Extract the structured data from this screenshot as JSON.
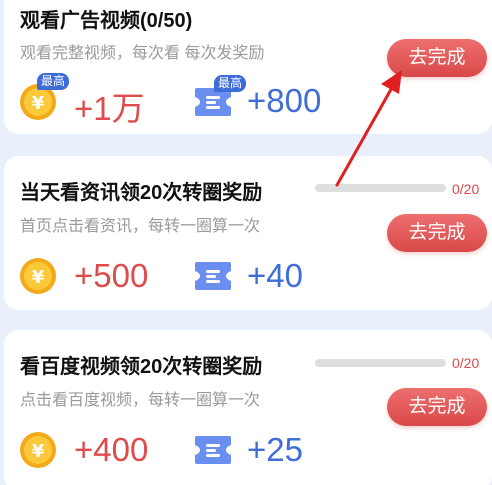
{
  "tasks": [
    {
      "title": "观看广告视频(0/50)",
      "desc": "观看完整视频，每次看 每次发奖励",
      "button": "去完成",
      "coin_amount": "+1万",
      "ticket_amount": "+800",
      "coin_badge": "最高",
      "ticket_badge": "最高"
    },
    {
      "title": "当天看资讯领20次转圈奖励",
      "desc": "首页点击看资讯，每转一圈算一次",
      "button": "去完成",
      "progress_text": "0/20",
      "progress": 0,
      "coin_amount": "+500",
      "ticket_amount": "+40"
    },
    {
      "title": "看百度视频领20次转圈奖励",
      "desc": "点击看百度视频，每转一圈算一次",
      "button": "去完成",
      "progress_text": "0/20",
      "progress": 0,
      "coin_amount": "+400",
      "ticket_amount": "+25"
    }
  ],
  "colors": {
    "accent_red": "#de4b4b",
    "accent_blue": "#3f6ed8",
    "annotation_arrow": "#e02020"
  },
  "icons": {
    "coin": "yuan-coin-icon",
    "ticket": "ticket-icon"
  }
}
